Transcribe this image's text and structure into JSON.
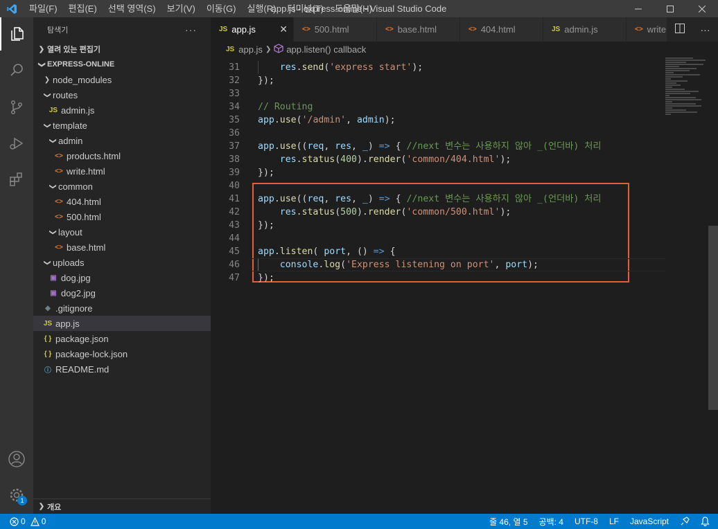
{
  "window": {
    "title": "app.js - express-online - Visual Studio Code",
    "menu": [
      "파일(F)",
      "편집(E)",
      "선택 영역(S)",
      "보기(V)",
      "이동(G)",
      "실행(R)",
      "터미널(T)",
      "도움말(H)"
    ]
  },
  "sidebar": {
    "title": "탐색기",
    "more": "···",
    "open_editors": "열려 있는 편집기",
    "project": "EXPRESS-ONLINE",
    "outline": "개요",
    "tree": [
      {
        "label": "node_modules",
        "type": "folder",
        "open": false,
        "depth": 1
      },
      {
        "label": "routes",
        "type": "folder",
        "open": true,
        "depth": 1
      },
      {
        "label": "admin.js",
        "type": "js",
        "depth": 2
      },
      {
        "label": "template",
        "type": "folder",
        "open": true,
        "depth": 1
      },
      {
        "label": "admin",
        "type": "folder",
        "open": true,
        "depth": 2
      },
      {
        "label": "products.html",
        "type": "html",
        "depth": 3
      },
      {
        "label": "write.html",
        "type": "html",
        "depth": 3
      },
      {
        "label": "common",
        "type": "folder",
        "open": true,
        "depth": 2
      },
      {
        "label": "404.html",
        "type": "html",
        "depth": 3
      },
      {
        "label": "500.html",
        "type": "html",
        "depth": 3
      },
      {
        "label": "layout",
        "type": "folder",
        "open": true,
        "depth": 2
      },
      {
        "label": "base.html",
        "type": "html",
        "depth": 3
      },
      {
        "label": "uploads",
        "type": "folder",
        "open": true,
        "depth": 1
      },
      {
        "label": "dog.jpg",
        "type": "img",
        "depth": 2
      },
      {
        "label": "dog2.jpg",
        "type": "img",
        "depth": 2
      },
      {
        "label": ".gitignore",
        "type": "git",
        "depth": 1
      },
      {
        "label": "app.js",
        "type": "js",
        "depth": 1,
        "selected": true
      },
      {
        "label": "package.json",
        "type": "json",
        "depth": 1
      },
      {
        "label": "package-lock.json",
        "type": "json",
        "depth": 1
      },
      {
        "label": "README.md",
        "type": "info",
        "depth": 1
      }
    ]
  },
  "tabs": [
    {
      "label": "app.js",
      "type": "js",
      "active": true
    },
    {
      "label": "500.html",
      "type": "html"
    },
    {
      "label": "base.html",
      "type": "html"
    },
    {
      "label": "404.html",
      "type": "html"
    },
    {
      "label": "admin.js",
      "type": "js"
    },
    {
      "label": "write",
      "type": "html"
    }
  ],
  "breadcrumb": {
    "file": "app.js",
    "symbol": "app.listen() callback"
  },
  "code": [
    {
      "n": "31",
      "tokens": [
        [
          "    ",
          ""
        ],
        [
          "res",
          "vr"
        ],
        [
          ".",
          ""
        ],
        [
          "send",
          "fn"
        ],
        [
          "(",
          ""
        ],
        [
          "'express start'",
          "str"
        ],
        [
          ");",
          ""
        ]
      ]
    },
    {
      "n": "32",
      "tokens": [
        [
          "});",
          ""
        ]
      ]
    },
    {
      "n": "33",
      "tokens": []
    },
    {
      "n": "34",
      "tokens": [
        [
          "// Routing",
          "cm"
        ]
      ]
    },
    {
      "n": "35",
      "tokens": [
        [
          "app",
          "vr"
        ],
        [
          ".",
          ""
        ],
        [
          "use",
          "fn"
        ],
        [
          "(",
          ""
        ],
        [
          "'/admin'",
          "str"
        ],
        [
          ", ",
          ""
        ],
        [
          "admin",
          "vr"
        ],
        [
          ");",
          ""
        ]
      ]
    },
    {
      "n": "36",
      "tokens": []
    },
    {
      "n": "37",
      "tokens": [
        [
          "app",
          "vr"
        ],
        [
          ".",
          ""
        ],
        [
          "use",
          "fn"
        ],
        [
          "((",
          ""
        ],
        [
          "req",
          "vr"
        ],
        [
          ", ",
          ""
        ],
        [
          "res",
          "vr"
        ],
        [
          ", ",
          ""
        ],
        [
          "_",
          "vr"
        ],
        [
          ") ",
          ""
        ],
        [
          "=>",
          "kw"
        ],
        [
          " { ",
          ""
        ],
        [
          "//next 변수는 사용하지 않아 _(언더바) 처리",
          "cm"
        ]
      ]
    },
    {
      "n": "38",
      "tokens": [
        [
          "    ",
          ""
        ],
        [
          "res",
          "vr"
        ],
        [
          ".",
          ""
        ],
        [
          "status",
          "fn"
        ],
        [
          "(",
          ""
        ],
        [
          "400",
          "num"
        ],
        [
          ").",
          ""
        ],
        [
          "render",
          "fn"
        ],
        [
          "(",
          ""
        ],
        [
          "'common/404.html'",
          "str"
        ],
        [
          ");",
          ""
        ]
      ]
    },
    {
      "n": "39",
      "tokens": [
        [
          "});",
          ""
        ]
      ]
    },
    {
      "n": "40",
      "tokens": []
    },
    {
      "n": "41",
      "tokens": [
        [
          "app",
          "vr"
        ],
        [
          ".",
          ""
        ],
        [
          "use",
          "fn"
        ],
        [
          "((",
          ""
        ],
        [
          "req",
          "vr"
        ],
        [
          ", ",
          ""
        ],
        [
          "res",
          "vr"
        ],
        [
          ", ",
          ""
        ],
        [
          "_",
          "vr"
        ],
        [
          ") ",
          ""
        ],
        [
          "=>",
          "kw"
        ],
        [
          " { ",
          ""
        ],
        [
          "//next 변수는 사용하지 않아 _(언더바) 처리",
          "cm"
        ]
      ]
    },
    {
      "n": "42",
      "tokens": [
        [
          "    ",
          ""
        ],
        [
          "res",
          "vr"
        ],
        [
          ".",
          ""
        ],
        [
          "status",
          "fn"
        ],
        [
          "(",
          ""
        ],
        [
          "500",
          "num"
        ],
        [
          ").",
          ""
        ],
        [
          "render",
          "fn"
        ],
        [
          "(",
          ""
        ],
        [
          "'common/500.html'",
          "str"
        ],
        [
          ");",
          ""
        ]
      ]
    },
    {
      "n": "43",
      "tokens": [
        [
          "});",
          ""
        ]
      ]
    },
    {
      "n": "44",
      "tokens": []
    },
    {
      "n": "45",
      "tokens": [
        [
          "app",
          "vr"
        ],
        [
          ".",
          ""
        ],
        [
          "listen",
          "fn"
        ],
        [
          "( ",
          ""
        ],
        [
          "port",
          "vr"
        ],
        [
          ", () ",
          ""
        ],
        [
          "=>",
          "kw"
        ],
        [
          " {",
          ""
        ]
      ]
    },
    {
      "n": "46",
      "tokens": [
        [
          "    ",
          ""
        ],
        [
          "console",
          "vr"
        ],
        [
          ".",
          ""
        ],
        [
          "log",
          "fn"
        ],
        [
          "(",
          ""
        ],
        [
          "'Express listening on port'",
          "str"
        ],
        [
          ", ",
          ""
        ],
        [
          "port",
          "vr"
        ],
        [
          ");",
          ""
        ]
      ],
      "current": true
    },
    {
      "n": "47",
      "tokens": [
        [
          "});",
          ""
        ]
      ]
    }
  ],
  "status": {
    "errors": "0",
    "warnings": "0",
    "position": "줄 46, 열 5",
    "spaces": "공백: 4",
    "encoding": "UTF-8",
    "eol": "LF",
    "language": "JavaScript"
  },
  "badge_count": "1",
  "colors": {
    "accent": "#007acc",
    "highlight_box": "#e35f35",
    "js_icon": "#cbcb41",
    "html_icon": "#e37933",
    "json_icon": "#cbcb41"
  }
}
